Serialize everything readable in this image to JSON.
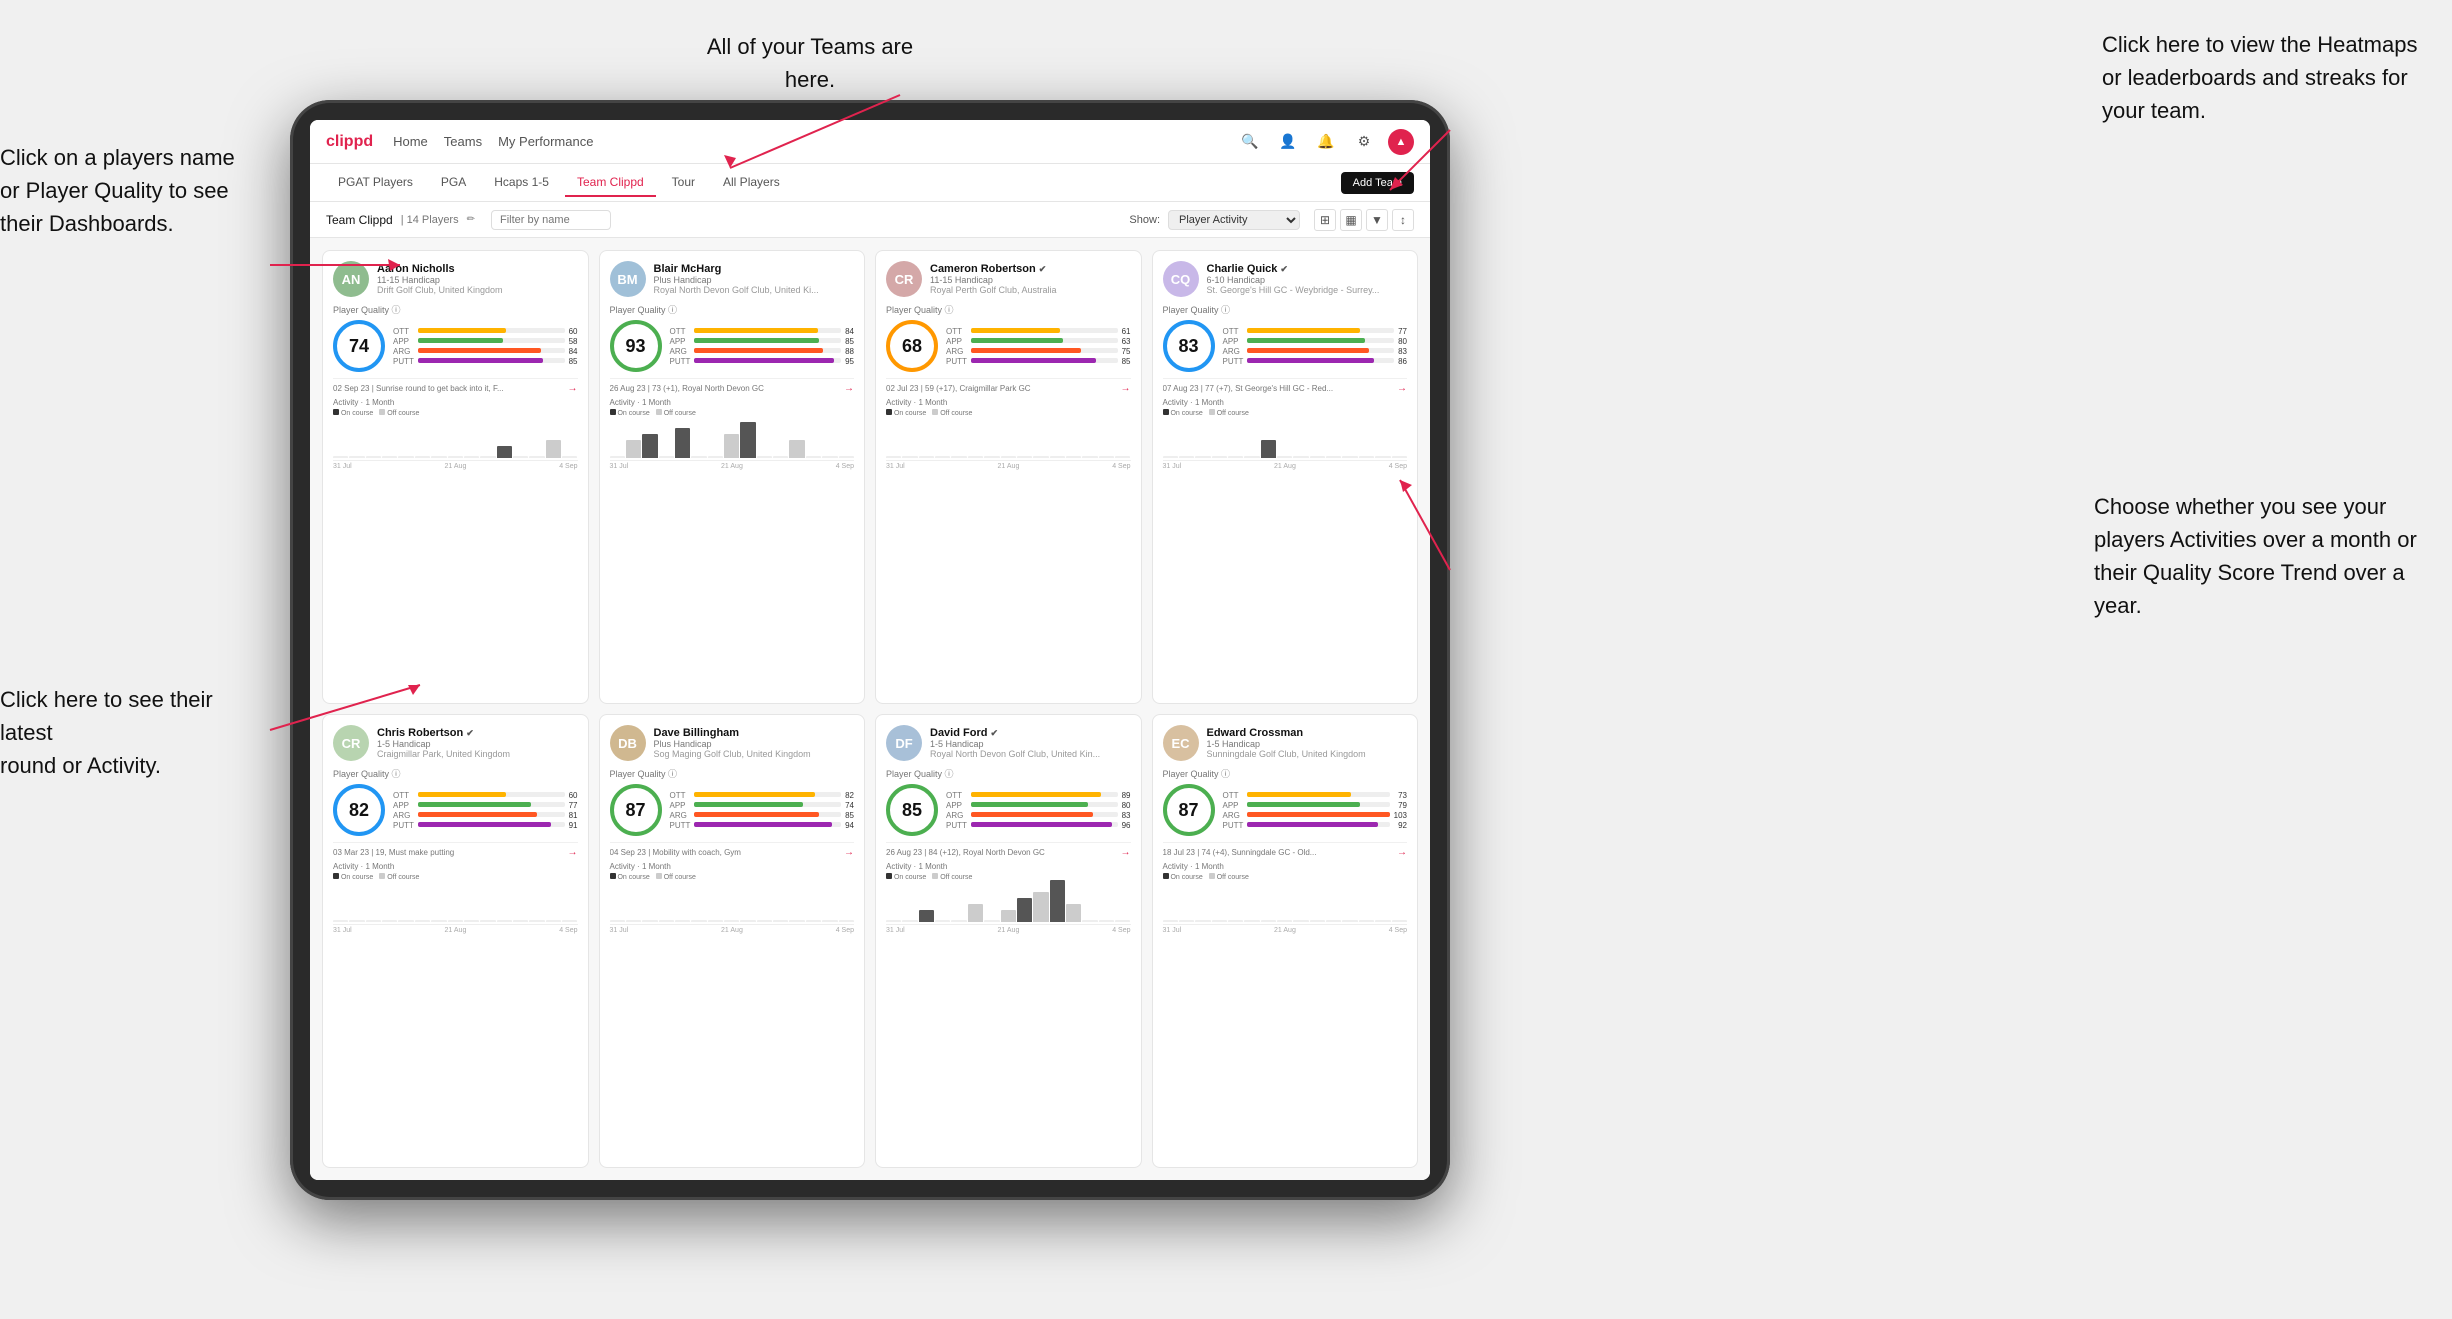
{
  "annotations": {
    "teams": "All of your Teams are here.",
    "heatmaps": "Click here to view the Heatmaps or leaderboards and streaks for your team.",
    "players_name": "Click on a players name\nor Player Quality to see\ntheir Dashboards.",
    "round": "Click here to see their latest\nround or Activity.",
    "choose": "Choose whether you see\nyour players Activities over\na month or their Quality\nScore Trend over a year."
  },
  "nav": {
    "logo": "clippd",
    "links": [
      "Home",
      "Teams",
      "My Performance"
    ],
    "active": "Teams"
  },
  "sub_tabs": {
    "tabs": [
      "PGAT Players",
      "PGA",
      "Hcaps 1-5",
      "Team Clippd",
      "Tour",
      "All Players"
    ],
    "active": "Team Clippd",
    "add_button": "Add Team"
  },
  "team_header": {
    "title": "Team Clippd",
    "separator": "|",
    "count": "14 Players",
    "filter_placeholder": "Filter by name",
    "show_label": "Show:",
    "show_value": "Player Activity"
  },
  "players": [
    {
      "name": "Aaron Nicholls",
      "handicap": "11-15 Handicap",
      "club": "Drift Golf Club, United Kingdom",
      "score": 74,
      "score_color": "blue",
      "stats": {
        "ott": {
          "val": 60,
          "pct": 60
        },
        "app": {
          "val": 58,
          "pct": 58
        },
        "arg": {
          "val": 84,
          "pct": 84
        },
        "putt": {
          "val": 85,
          "pct": 85
        }
      },
      "recent": "02 Sep 23 | Sunrise round to get back into it, F...",
      "activity_bars": [
        0,
        0,
        0,
        0,
        0,
        0,
        0,
        0,
        0,
        0,
        2,
        0,
        0,
        3,
        0
      ],
      "dates": [
        "31 Jul",
        "21 Aug",
        "4 Sep"
      ],
      "verified": false,
      "avatar_color": "#8fbc8f",
      "avatar_letter": "AN"
    },
    {
      "name": "Blair McHarg",
      "handicap": "Plus Handicap",
      "club": "Royal North Devon Golf Club, United Ki...",
      "score": 93,
      "score_color": "green",
      "stats": {
        "ott": {
          "val": 84,
          "pct": 84
        },
        "app": {
          "val": 85,
          "pct": 85
        },
        "arg": {
          "val": 88,
          "pct": 88
        },
        "putt": {
          "val": 95,
          "pct": 95
        }
      },
      "recent": "26 Aug 23 | 73 (+1), Royal North Devon GC",
      "activity_bars": [
        0,
        3,
        4,
        0,
        5,
        0,
        0,
        4,
        6,
        0,
        0,
        3,
        0,
        0,
        0
      ],
      "dates": [
        "31 Jul",
        "21 Aug",
        "4 Sep"
      ],
      "verified": false,
      "avatar_color": "#a0c0d8",
      "avatar_letter": "BM"
    },
    {
      "name": "Cameron Robertson",
      "handicap": "11-15 Handicap",
      "club": "Royal Perth Golf Club, Australia",
      "score": 68,
      "score_color": "orange",
      "stats": {
        "ott": {
          "val": 61,
          "pct": 61
        },
        "app": {
          "val": 63,
          "pct": 63
        },
        "arg": {
          "val": 75,
          "pct": 75
        },
        "putt": {
          "val": 85,
          "pct": 85
        }
      },
      "recent": "02 Jul 23 | 59 (+17), Craigmillar Park GC",
      "activity_bars": [
        0,
        0,
        0,
        0,
        0,
        0,
        0,
        0,
        0,
        0,
        0,
        0,
        0,
        0,
        0
      ],
      "dates": [
        "31 Jul",
        "21 Aug",
        "4 Sep"
      ],
      "verified": true,
      "avatar_color": "#d4a8a8",
      "avatar_letter": "CR"
    },
    {
      "name": "Charlie Quick",
      "handicap": "6-10 Handicap",
      "club": "St. George's Hill GC - Weybridge - Surrey...",
      "score": 83,
      "score_color": "blue",
      "stats": {
        "ott": {
          "val": 77,
          "pct": 77
        },
        "app": {
          "val": 80,
          "pct": 80
        },
        "arg": {
          "val": 83,
          "pct": 83
        },
        "putt": {
          "val": 86,
          "pct": 86
        }
      },
      "recent": "07 Aug 23 | 77 (+7), St George's Hill GC - Red...",
      "activity_bars": [
        0,
        0,
        0,
        0,
        0,
        0,
        3,
        0,
        0,
        0,
        0,
        0,
        0,
        0,
        0
      ],
      "dates": [
        "31 Jul",
        "21 Aug",
        "4 Sep"
      ],
      "verified": true,
      "avatar_color": "#c8b8e8",
      "avatar_letter": "CQ"
    },
    {
      "name": "Chris Robertson",
      "handicap": "1-5 Handicap",
      "club": "Craigmillar Park, United Kingdom",
      "score": 82,
      "score_color": "blue",
      "stats": {
        "ott": {
          "val": 60,
          "pct": 60
        },
        "app": {
          "val": 77,
          "pct": 77
        },
        "arg": {
          "val": 81,
          "pct": 81
        },
        "putt": {
          "val": 91,
          "pct": 91
        }
      },
      "recent": "03 Mar 23 | 19, Must make putting",
      "activity_bars": [
        0,
        0,
        0,
        0,
        0,
        0,
        0,
        0,
        0,
        0,
        0,
        0,
        0,
        0,
        0
      ],
      "dates": [
        "31 Jul",
        "21 Aug",
        "4 Sep"
      ],
      "verified": true,
      "avatar_color": "#b8d4b0",
      "avatar_letter": "CR"
    },
    {
      "name": "Dave Billingham",
      "handicap": "Plus Handicap",
      "club": "Sog Maging Golf Club, United Kingdom",
      "score": 87,
      "score_color": "green",
      "stats": {
        "ott": {
          "val": 82,
          "pct": 82
        },
        "app": {
          "val": 74,
          "pct": 74
        },
        "arg": {
          "val": 85,
          "pct": 85
        },
        "putt": {
          "val": 94,
          "pct": 94
        }
      },
      "recent": "04 Sep 23 | Mobility with coach, Gym",
      "activity_bars": [
        0,
        0,
        0,
        0,
        0,
        0,
        0,
        0,
        0,
        0,
        0,
        0,
        0,
        0,
        0
      ],
      "dates": [
        "31 Jul",
        "21 Aug",
        "4 Sep"
      ],
      "verified": false,
      "avatar_color": "#d0b890",
      "avatar_letter": "DB"
    },
    {
      "name": "David Ford",
      "handicap": "1-5 Handicap",
      "club": "Royal North Devon Golf Club, United Kin...",
      "score": 85,
      "score_color": "green",
      "stats": {
        "ott": {
          "val": 89,
          "pct": 89
        },
        "app": {
          "val": 80,
          "pct": 80
        },
        "arg": {
          "val": 83,
          "pct": 83
        },
        "putt": {
          "val": 96,
          "pct": 96
        }
      },
      "recent": "26 Aug 23 | 84 (+12), Royal North Devon GC",
      "activity_bars": [
        0,
        0,
        2,
        0,
        0,
        3,
        0,
        2,
        4,
        5,
        7,
        3,
        0,
        0,
        0
      ],
      "dates": [
        "31 Jul",
        "21 Aug",
        "4 Sep"
      ],
      "verified": true,
      "avatar_color": "#a8c0d8",
      "avatar_letter": "DF"
    },
    {
      "name": "Edward Crossman",
      "handicap": "1-5 Handicap",
      "club": "Sunningdale Golf Club, United Kingdom",
      "score": 87,
      "score_color": "green",
      "stats": {
        "ott": {
          "val": 73,
          "pct": 73
        },
        "app": {
          "val": 79,
          "pct": 79
        },
        "arg": {
          "val": 103,
          "pct": 100
        },
        "putt": {
          "val": 92,
          "pct": 92
        }
      },
      "recent": "18 Jul 23 | 74 (+4), Sunningdale GC - Old...",
      "activity_bars": [
        0,
        0,
        0,
        0,
        0,
        0,
        0,
        0,
        0,
        0,
        0,
        0,
        0,
        0,
        0
      ],
      "dates": [
        "31 Jul",
        "21 Aug",
        "4 Sep"
      ],
      "verified": false,
      "avatar_color": "#d8c0a0",
      "avatar_letter": "EC"
    }
  ]
}
